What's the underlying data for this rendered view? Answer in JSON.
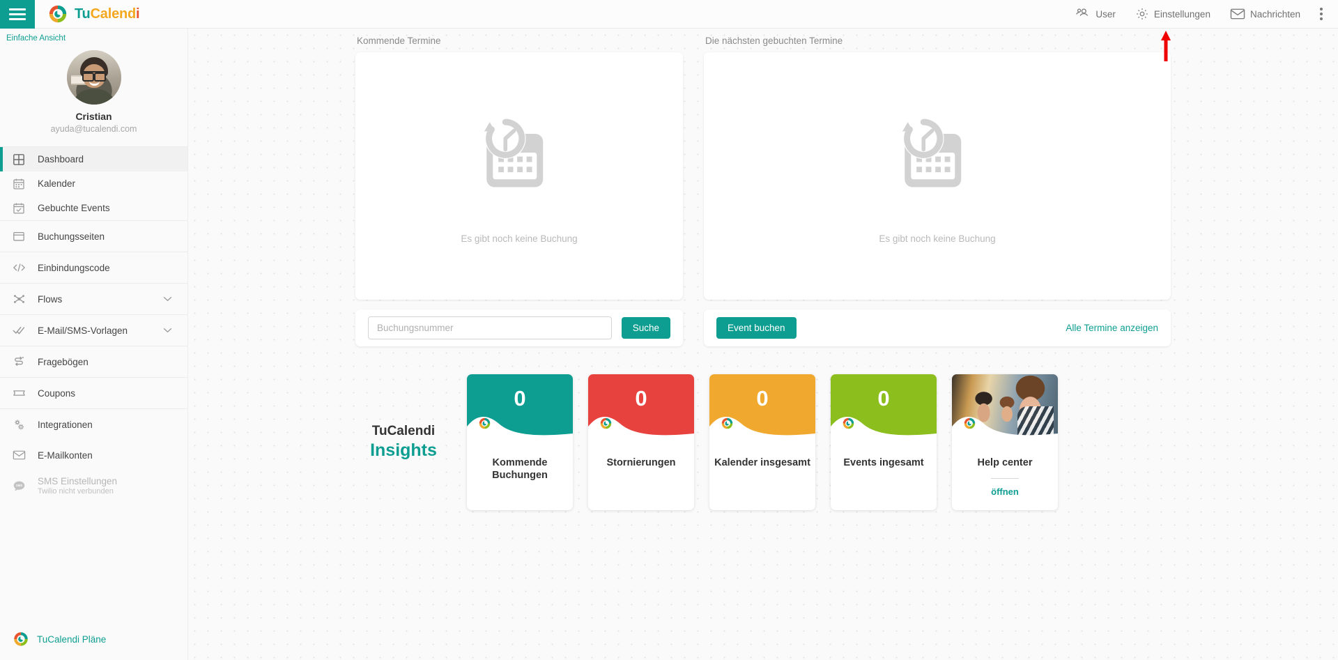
{
  "header": {
    "menu_icon": "hamburger-icon",
    "brand": {
      "part1": "Tu",
      "part2": "Calend",
      "part3": "i"
    },
    "items": [
      {
        "label": "User",
        "icon": "users-icon"
      },
      {
        "label": "Einstellungen",
        "icon": "gear-icon"
      },
      {
        "label": "Nachrichten",
        "icon": "envelope-icon"
      }
    ],
    "overflow_icon": "kebab-menu-icon"
  },
  "sidebar": {
    "view_mode": "Einfache Ansicht",
    "profile": {
      "name": "Cristian",
      "email": "ayuda@tucalendi.com"
    },
    "items": [
      {
        "label": "Dashboard",
        "icon": "grid-icon",
        "active": true
      },
      {
        "label": "Kalender",
        "icon": "calendar-icon"
      },
      {
        "label": "Gebuchte Events",
        "icon": "calendar-check-icon"
      },
      {
        "label": "Buchungsseiten",
        "icon": "window-icon"
      },
      {
        "label": "Einbindungscode",
        "icon": "code-icon"
      },
      {
        "label": "Flows",
        "icon": "flow-nodes-icon",
        "expandable": true
      },
      {
        "label": "E-Mail/SMS-Vorlagen",
        "icon": "double-check-icon",
        "expandable": true
      },
      {
        "label": "Fragebögen",
        "icon": "survey-icon"
      },
      {
        "label": "Coupons",
        "icon": "ticket-icon"
      },
      {
        "label": "Integrationen",
        "icon": "gears-icon"
      },
      {
        "label": "E-Mailkonten",
        "icon": "envelope-icon"
      },
      {
        "label": "SMS Einstellungen",
        "sublabel": "Twilio nicht verbunden",
        "icon": "sms-bubble-icon",
        "disabled": true
      }
    ],
    "footer": {
      "label": "TuCalendi Pläne",
      "icon": "tucalendi-logo-icon"
    }
  },
  "main": {
    "upcoming_panel": {
      "title": "Kommende Termine",
      "empty_text": "Es gibt noch keine Buchung",
      "empty_icon": "calendar-clock-icon",
      "search_placeholder": "Buchungsnummer",
      "search_value": "",
      "search_button": "Suche"
    },
    "booked_panel": {
      "title": "Die nächsten gebuchten Termine",
      "empty_text": "Es gibt noch keine Buchung",
      "empty_icon": "calendar-clock-icon",
      "book_button": "Event buchen",
      "view_all_link": "Alle Termine anzeigen"
    },
    "insights": {
      "title_line1": "TuCalendi",
      "title_line2": "Insights",
      "cards": [
        {
          "value": "0",
          "label": "Kommende Buchungen",
          "color": "#0d9e91"
        },
        {
          "value": "0",
          "label": "Stornierungen",
          "color": "#e8423f"
        },
        {
          "value": "0",
          "label": "Kalender insgesamt",
          "color": "#f0a92e"
        },
        {
          "value": "0",
          "label": "Events ingesamt",
          "color": "#8cbe1e"
        }
      ],
      "help_card": {
        "title": "Help center",
        "link": "öffnen",
        "image": "people-meeting-photo"
      }
    }
  },
  "annotation": {
    "arrow": "red-up-arrow",
    "points_to": "Einstellungen"
  }
}
